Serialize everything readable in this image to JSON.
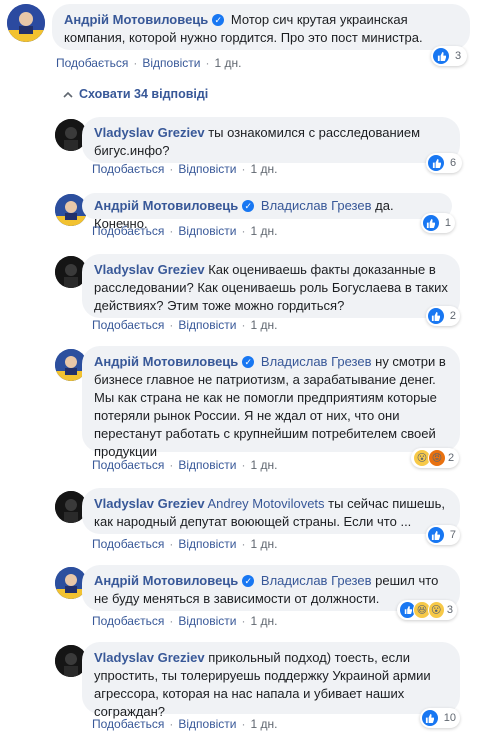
{
  "top_comment": {
    "author": "Андрій Мотовиловець",
    "text": "Мотор сич крутая украинская компания, которой нужно гордится. Про это пост министра.",
    "like_label": "Подобається",
    "reply_label": "Відповісти",
    "time": "1 дн.",
    "reactions": "3"
  },
  "hide_replies": "Сховати 34 відповіді",
  "replies": [
    {
      "author": "Vladyslav Greziev",
      "mention": "",
      "text": "ты ознакомился с расследованием бигус.инфо?",
      "like": "Подобається",
      "reply": "Відповісти",
      "time": "1 дн.",
      "reactions": "6"
    },
    {
      "author": "Андрій Мотовиловець",
      "mention": "Владислав Грезев",
      "text": "да. Конечно.",
      "like": "Подобається",
      "reply": "Відповісти",
      "time": "1 дн.",
      "reactions": "1"
    },
    {
      "author": "Vladyslav Greziev",
      "mention": "",
      "text": "Как оцениваешь факты доказанные в расследовании? Как оцениваешь роль Богуслаева в таких действиях? Этим тоже можно гордиться?",
      "like": "Подобається",
      "reply": "Відповісти",
      "time": "1 дн.",
      "reactions": "2"
    },
    {
      "author": "Андрій Мотовиловець",
      "mention": "Владислав Грезев",
      "text": "ну смотри в бизнесе главное не патриотизм, а зарабатывание денег. Мы как страна не как не помогли предприятиям которые потеряли рынок России. Я не ждал от них, что они перестанут работать с крупнейшим потребителем своей продукции",
      "like": "Подобається",
      "reply": "Відповісти",
      "time": "1 дн.",
      "reactions": "2"
    },
    {
      "author": "Vladyslav Greziev",
      "mention": "Andrey Motovilovets",
      "text": "ты сейчас пишешь, как народный депутат воюющей страны. Если что ...",
      "like": "Подобається",
      "reply": "Відповісти",
      "time": "1 дн.",
      "reactions": "7"
    },
    {
      "author": "Андрій Мотовиловець",
      "mention": "Владислав Грезев",
      "text": "решил что не буду меняться в зависимости от должности.",
      "like": "Подобається",
      "reply": "Відповісти",
      "time": "1 дн.",
      "reactions": "3"
    },
    {
      "author": "Vladyslav Greziev",
      "mention": "",
      "text": "прикольный подход) тоесть, если упростить, ты толерируешь поддержку Украиной армии агрессора, которая на нас напала и убивает наших сограждан?",
      "like": "Подобається",
      "reply": "Відповісти",
      "time": "1 дн.",
      "reactions": "10"
    }
  ],
  "colors": {
    "link": "#385898",
    "bubble": "#f0f2f5",
    "like_blue": "#1877f2"
  }
}
